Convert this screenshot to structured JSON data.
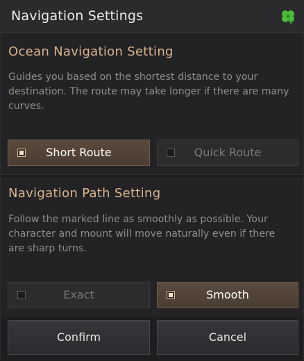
{
  "window": {
    "title": "Navigation Settings",
    "icon": "four-leaf-clover-icon"
  },
  "ocean": {
    "title": "Ocean Navigation Setting",
    "description": "Guides you based on the shortest distance to your destination. The route may take longer if there are many curves.",
    "options": [
      {
        "label": "Short Route",
        "selected": true
      },
      {
        "label": "Quick Route",
        "selected": false
      }
    ]
  },
  "path": {
    "title": "Navigation Path Setting",
    "description": "Follow the marked line as smoothly as possible. Your character and mount will move naturally even if there are sharp turns.",
    "options": [
      {
        "label": "Exact",
        "selected": false
      },
      {
        "label": "Smooth",
        "selected": true
      }
    ]
  },
  "footer": {
    "confirm_label": "Confirm",
    "cancel_label": "Cancel"
  },
  "colors": {
    "accent_title": "#d9b48e",
    "selected_fill": "#4f4135",
    "clover_green": "#4dbb3a"
  }
}
